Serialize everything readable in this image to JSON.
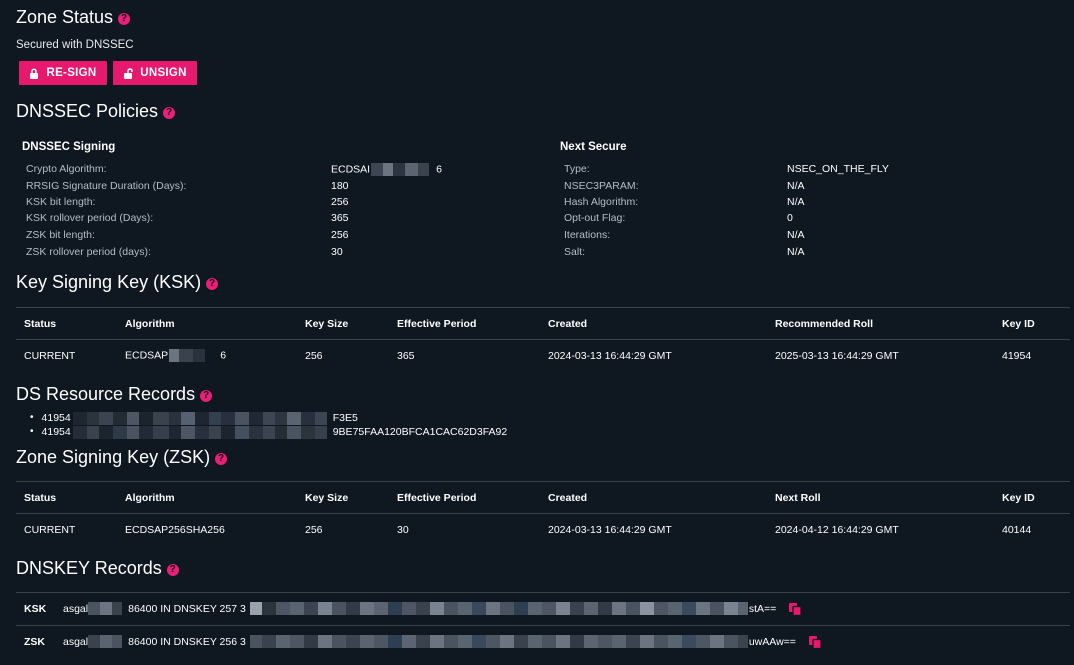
{
  "zone_status": {
    "title": "Zone Status",
    "secured_text": "Secured with DNSSEC",
    "resign_label": "RE-SIGN",
    "unsign_label": "UNSIGN"
  },
  "policies": {
    "title": "DNSSEC Policies",
    "signing": {
      "heading": "DNSSEC Signing",
      "rows": [
        {
          "label": "Crypto Algorithm:",
          "value_start": "ECDSAI",
          "value_end": "6"
        },
        {
          "label": "RRSIG Signature Duration (Days):",
          "value": "180"
        },
        {
          "label": "KSK bit length:",
          "value": "256"
        },
        {
          "label": "KSK rollover period (Days):",
          "value": "365"
        },
        {
          "label": "ZSK bit length:",
          "value": "256"
        },
        {
          "label": "ZSK rollover period (days):",
          "value": "30"
        }
      ]
    },
    "next_secure": {
      "heading": "Next Secure",
      "rows": [
        {
          "label": "Type:",
          "value": "NSEC_ON_THE_FLY"
        },
        {
          "label": "NSEC3PARAM:",
          "value": "N/A"
        },
        {
          "label": "Hash Algorithm:",
          "value": "N/A"
        },
        {
          "label": "Opt-out Flag:",
          "value": "0"
        },
        {
          "label": "Iterations:",
          "value": "N/A"
        },
        {
          "label": "Salt:",
          "value": "N/A"
        }
      ]
    }
  },
  "ksk": {
    "title": "Key Signing Key (KSK)",
    "headers": [
      "Status",
      "Algorithm",
      "Key Size",
      "Effective Period",
      "Created",
      "Recommended Roll",
      "Key ID"
    ],
    "row": {
      "status": "CURRENT",
      "algorithm_start": "ECDSAP",
      "algorithm_end": "6",
      "key_size": "256",
      "period": "365",
      "created": "2024-03-13 16:44:29 GMT",
      "roll": "2025-03-13 16:44:29 GMT",
      "key_id": "41954"
    }
  },
  "ds": {
    "title": "DS Resource Records",
    "items": [
      {
        "prefix": "41954",
        "suffix": "F3E5"
      },
      {
        "prefix": "41954",
        "suffix": "9BE75FAA120BFCA1CAC62D3FA92"
      }
    ]
  },
  "zsk": {
    "title": "Zone Signing Key (ZSK)",
    "headers": [
      "Status",
      "Algorithm",
      "Key Size",
      "Effective Period",
      "Created",
      "Next Roll",
      "Key ID"
    ],
    "row": {
      "status": "CURRENT",
      "algorithm": "ECDSAP256SHA256",
      "key_size": "256",
      "period": "30",
      "created": "2024-03-13 16:44:29 GMT",
      "roll": "2024-04-12 16:44:29 GMT",
      "key_id": "40144"
    }
  },
  "dnskey": {
    "title": "DNSKEY Records",
    "rows": [
      {
        "kind": "KSK",
        "name": "asgal",
        "record": "86400 IN DNSKEY 257 3",
        "tail": "stA=="
      },
      {
        "kind": "ZSK",
        "name": "asgal",
        "record": "86400 IN DNSKEY 256 3",
        "tail": "uwAAw=="
      }
    ]
  },
  "colors": {
    "background": "#0f1720",
    "accent": "#e6196f",
    "divider": "#3a434d",
    "label_text": "#b6bcc4"
  },
  "icons": [
    "help-icon",
    "lock-icon",
    "unlock-icon",
    "copy-icon"
  ]
}
